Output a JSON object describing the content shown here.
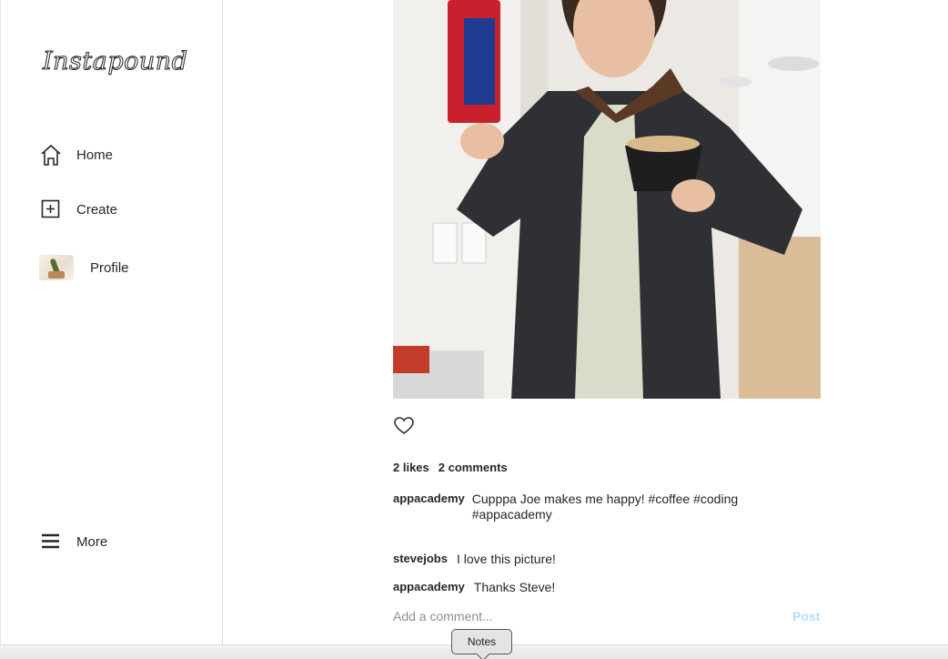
{
  "app": {
    "logo_text": "Instapound"
  },
  "sidebar": {
    "items": [
      {
        "label": "Home",
        "icon": "home-icon"
      },
      {
        "label": "Create",
        "icon": "plus-square-icon"
      },
      {
        "label": "Profile",
        "icon": "avatar"
      }
    ],
    "more": {
      "label": "More",
      "icon": "hamburger-icon"
    }
  },
  "post": {
    "image_alt": "Person holding a bag of coffee and a cup",
    "likes_text": "2 likes",
    "comments_count_text": "2 comments",
    "caption": {
      "user": "appacademy",
      "text": "Cupppa Joe makes me happy! #coffee #coding #appacademy"
    },
    "comments": [
      {
        "user": "stevejobs",
        "text": "I love this picture!"
      },
      {
        "user": "appacademy",
        "text": "Thanks Steve!"
      }
    ],
    "add_comment_placeholder": "Add a comment...",
    "post_button_label": "Post"
  },
  "dock_tooltip": {
    "label": "Notes"
  },
  "colors": {
    "post_button": "#b2dffc",
    "border": "#dbdbdb",
    "text": "#262626"
  }
}
